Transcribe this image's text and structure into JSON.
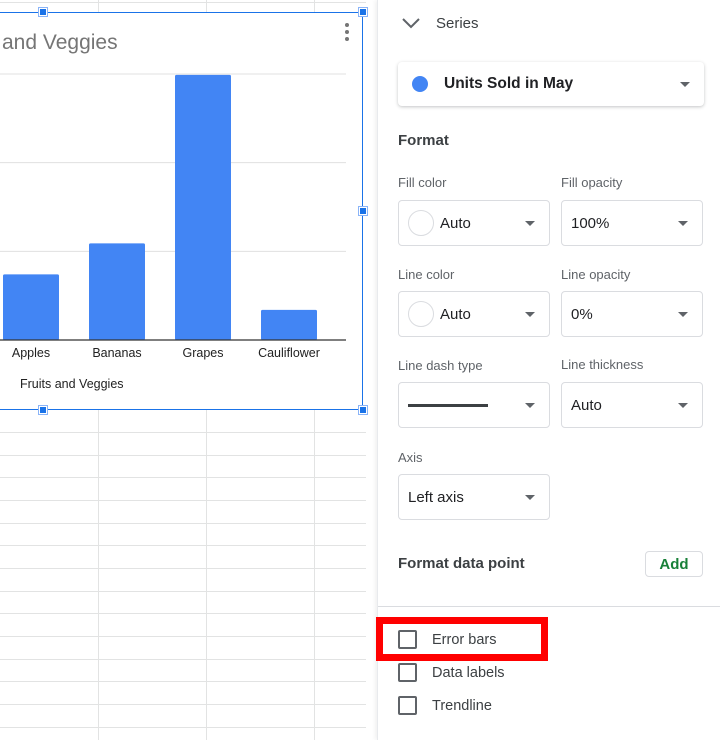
{
  "chart": {
    "title_visible": "and Veggies",
    "menu_icon": "more-vert-icon",
    "bar_color": "#4285f4"
  },
  "chart_data": {
    "type": "bar",
    "title": "Fruits and Veggies (title partially cut off; visible: \"and Veggies\")",
    "categories": [
      "Apples",
      "Bananas",
      "Grapes",
      "Cauliflower"
    ],
    "series": [
      {
        "name": "Units Sold in May",
        "values": [
          0.74,
          1.09,
          2.99,
          0.34
        ],
        "color": "#4285f4"
      }
    ],
    "value_units": "gridline steps (y-axis tick labels not visible)",
    "xlabel": "Fruits and Veggies",
    "ylabel": "",
    "ylim": [
      0,
      3
    ],
    "grid": true,
    "legend": "none"
  },
  "panel": {
    "section_title": "Series",
    "section_icon": "chevron-down-icon",
    "series_selected": "Units Sold in May",
    "series_color": "#4285f4",
    "format_heading": "Format",
    "fill_color_label": "Fill color",
    "fill_color_value": "Auto",
    "fill_opacity_label": "Fill opacity",
    "fill_opacity_value": "100%",
    "line_color_label": "Line color",
    "line_color_value": "Auto",
    "line_opacity_label": "Line opacity",
    "line_opacity_value": "0%",
    "line_dash_label": "Line dash type",
    "line_dash_value": "solid",
    "line_thickness_label": "Line thickness",
    "line_thickness_value": "Auto",
    "axis_label": "Axis",
    "axis_value": "Left axis",
    "format_data_point_label": "Format data point",
    "add_label": "Add",
    "checkboxes": [
      {
        "label": "Error bars",
        "checked": false,
        "highlighted": true
      },
      {
        "label": "Data labels",
        "checked": false
      },
      {
        "label": "Trendline",
        "checked": false
      }
    ]
  },
  "colors": {
    "accent_blue": "#1a73e8",
    "add_green": "#188038",
    "highlight_red": "#ff0000"
  }
}
